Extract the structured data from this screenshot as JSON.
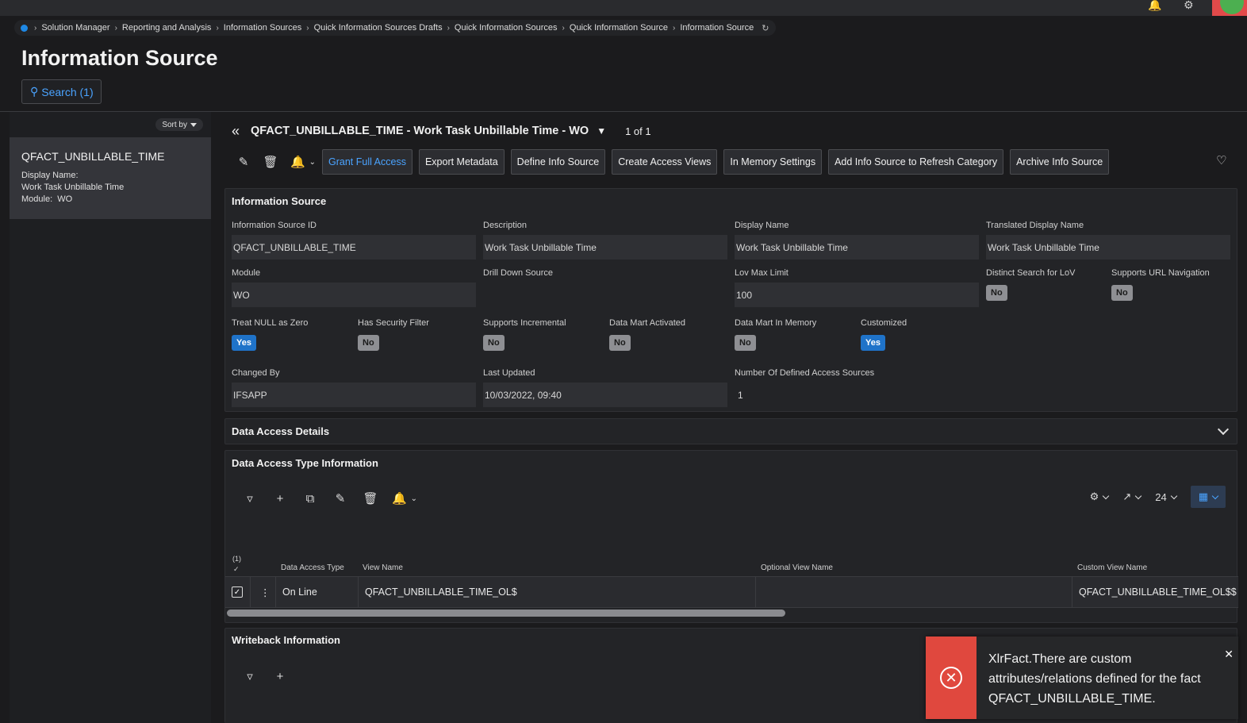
{
  "breadcrumb": [
    "Solution Manager",
    "Reporting and Analysis",
    "Information Sources",
    "Quick Information Sources Drafts",
    "Quick Information Sources",
    "Quick Information Source",
    "Information Source"
  ],
  "page_title": "Information Source",
  "search_label": "Search (1)",
  "sort_label": "Sort by",
  "list_item": {
    "title": "QFACT_UNBILLABLE_TIME",
    "display_name_label": "Display Name:",
    "display_name": "Work Task Unbillable Time",
    "module_label": "Module:",
    "module": "WO"
  },
  "record": {
    "title": "QFACT_UNBILLABLE_TIME - Work Task Unbillable Time - WO",
    "pager": "1 of 1"
  },
  "commands": [
    "Grant Full Access",
    "Export Metadata",
    "Define Info Source",
    "Create Access Views",
    "In Memory Settings",
    "Add Info Source to Refresh Category",
    "Archive Info Source"
  ],
  "info_section": {
    "title": "Information Source",
    "info_source_id_label": "Information Source ID",
    "info_source_id": "QFACT_UNBILLABLE_TIME",
    "description_label": "Description",
    "description": "Work Task Unbillable Time",
    "display_name_label": "Display Name",
    "display_name": "Work Task Unbillable Time",
    "translated_label": "Translated Display Name",
    "translated": "Work Task Unbillable Time",
    "module_label": "Module",
    "module": "WO",
    "drill_down_label": "Drill Down Source",
    "lov_label": "Lov Max Limit",
    "lov": "100",
    "distinct_label": "Distinct Search for LoV",
    "distinct": "No",
    "url_nav_label": "Supports URL Navigation",
    "url_nav": "No",
    "treat_null_label": "Treat NULL as Zero",
    "treat_null": "Yes",
    "security_label": "Has Security Filter",
    "security": "No",
    "incremental_label": "Supports Incremental",
    "incremental": "No",
    "datamart_label": "Data Mart Activated",
    "datamart": "No",
    "datamart_mem_label": "Data Mart In Memory",
    "datamart_mem": "No",
    "customized_label": "Customized",
    "customized": "Yes",
    "changed_by_label": "Changed By",
    "changed_by": "IFSAPP",
    "last_updated_label": "Last Updated",
    "last_updated": "10/03/2022, 09:40",
    "access_sources_label": "Number Of Defined Access Sources",
    "access_sources": "1"
  },
  "data_access_details": {
    "title": "Data Access Details"
  },
  "data_access_type": {
    "title": "Data Access Type Information",
    "page_size": "24",
    "selected_count": "(1)",
    "columns": [
      "Data Access Type",
      "View Name",
      "Optional View Name",
      "Custom View Name"
    ],
    "rows": [
      {
        "type": "On Line",
        "view": "QFACT_UNBILLABLE_TIME_OL$",
        "optional": "",
        "custom": "QFACT_UNBILLABLE_TIME_OL$$"
      }
    ]
  },
  "writeback": {
    "title": "Writeback Information"
  },
  "toast": {
    "message": "XlrFact.There are custom attributes/relations defined for the fact QFACT_UNBILLABLE_TIME.",
    "color": "#e0483e"
  },
  "colors": {
    "accent": "#4aa3ff",
    "yes_badge": "#1f73c9",
    "no_badge": "#8e8f93"
  }
}
